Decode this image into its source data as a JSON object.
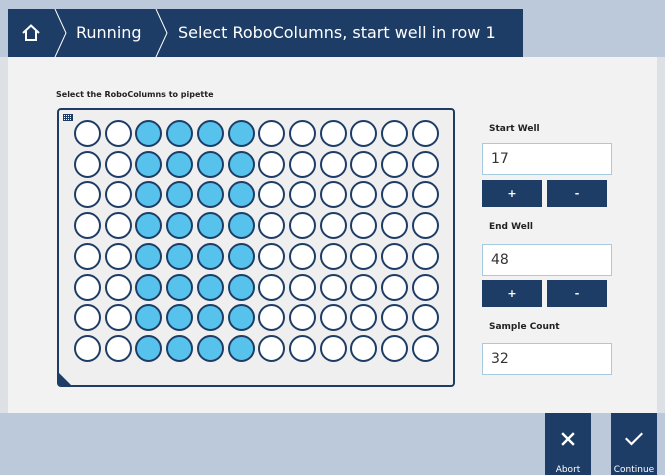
{
  "header": {
    "breadcrumb": [
      {
        "label": "Running"
      },
      {
        "label": "Select RoboColumns, start well in row 1"
      }
    ]
  },
  "plate": {
    "label": "Select the RoboColumns to pipette",
    "rows": 8,
    "columns": 12,
    "selected_columns": [
      3,
      4,
      5,
      6
    ]
  },
  "start_well": {
    "label": "Start Well",
    "value": "17",
    "plus": "+",
    "minus": "-"
  },
  "end_well": {
    "label": "End Well",
    "value": "48",
    "plus": "+",
    "minus": "-"
  },
  "sample_count": {
    "label": "Sample Count",
    "value": "32"
  },
  "footer": {
    "abort_label": "Abort",
    "continue_label": "Continue"
  },
  "colors": {
    "accent": "#1e3d66",
    "well_selected": "#57c3ed",
    "well_empty": "#ffffff"
  }
}
